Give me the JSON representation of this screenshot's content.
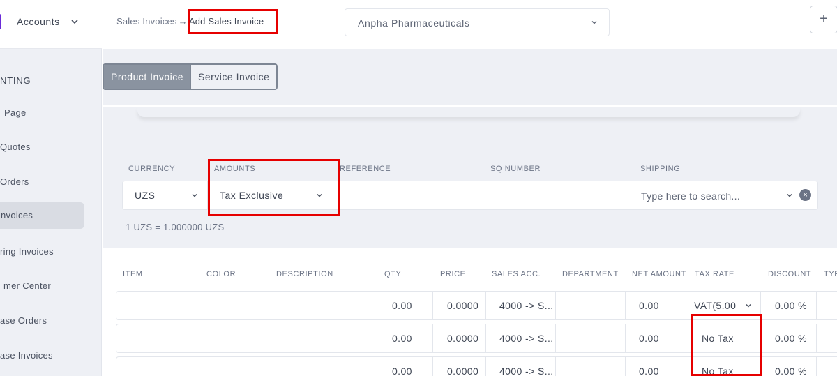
{
  "colors": {
    "highlight": "#e60000",
    "brand": "#6a2bd8",
    "tab_active_bg": "#8a93a0"
  },
  "sidebar": {
    "title": "Accounts",
    "section": "NTING",
    "items": [
      {
        "label": "Page",
        "active": false
      },
      {
        "label": "Quotes",
        "active": false
      },
      {
        "label": "Orders",
        "active": false
      },
      {
        "label": "nvoices",
        "active": true
      },
      {
        "label": "ring Invoices",
        "active": false
      },
      {
        "label": "mer Center",
        "active": false
      },
      {
        "label": "ase Orders",
        "active": false
      },
      {
        "label": "ase Invoices",
        "active": false
      }
    ]
  },
  "breadcrumb": {
    "parent": "Sales Invoices",
    "separator": "→",
    "current": "Add Sales Invoice"
  },
  "company_select": {
    "value": "Anpha Pharmaceuticals"
  },
  "add_button": {
    "label": "+"
  },
  "tabs": [
    {
      "label": "Product Invoice",
      "active": true
    },
    {
      "label": "Service Invoice",
      "active": false
    }
  ],
  "form": {
    "currency": {
      "label": "CURRENCY",
      "value": "UZS"
    },
    "amounts": {
      "label": "AMOUNTS",
      "value": "Tax Exclusive"
    },
    "reference": {
      "label": "REFERENCE",
      "value": ""
    },
    "sq_number": {
      "label": "SQ NUMBER",
      "value": ""
    },
    "shipping": {
      "label": "SHIPPING",
      "placeholder": "Type here to search..."
    },
    "rate_note": "1 UZS = 1.000000 UZS"
  },
  "table": {
    "headers": [
      "ITEM",
      "COLOR",
      "DESCRIPTION",
      "QTY",
      "PRICE",
      "SALES ACC.",
      "DEPARTMENT",
      "NET AMOUNT",
      "TAX RATE",
      "DISCOUNT",
      "TYP"
    ],
    "rows": [
      {
        "item": "",
        "color": "",
        "description": "",
        "qty": "0.00",
        "price": "0.0000",
        "sales_acc": "4000 -> S...",
        "department": "",
        "net_amount": "0.00",
        "tax_rate": "VAT(5.00",
        "discount": "0.00 %"
      },
      {
        "item": "",
        "color": "",
        "description": "",
        "qty": "0.00",
        "price": "0.0000",
        "sales_acc": "4000 -> S...",
        "department": "",
        "net_amount": "0.00",
        "tax_rate": "No Tax",
        "discount": "0.00 %"
      },
      {
        "item": "",
        "color": "",
        "description": "",
        "qty": "0.00",
        "price": "0.0000",
        "sales_acc": "4000 -> S...",
        "department": "",
        "net_amount": "0.00",
        "tax_rate": "No Tax",
        "discount": "0.00 %"
      }
    ]
  }
}
